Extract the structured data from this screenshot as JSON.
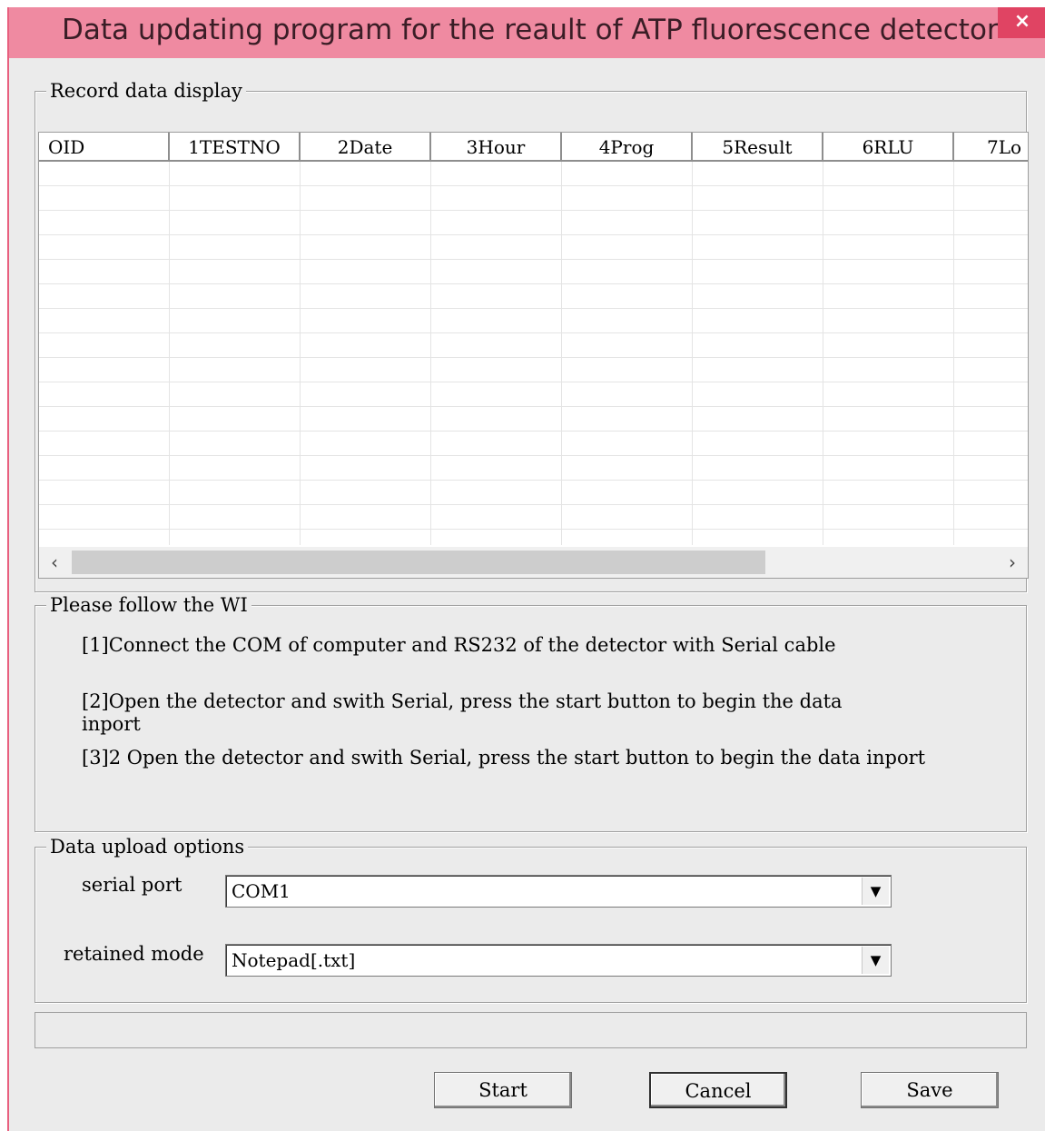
{
  "window": {
    "title": "Data updating program for the reault of ATP fluorescence detector",
    "close_label": "×"
  },
  "record_group": {
    "legend": "Record data display",
    "columns": [
      "OID",
      "1TESTNO",
      "2Date",
      "3Hour",
      "4Prog",
      "5Result",
      "6RLU",
      "7Lo"
    ],
    "rows": [],
    "scroll_left": "‹",
    "scroll_right": "›"
  },
  "wi_group": {
    "legend": "Please follow the WI",
    "steps": [
      "[1]Connect the COM of computer and RS232 of the detector with Serial cable",
      "[2]Open the detector and swith Serial, press the start button to begin the data inport",
      "[3]2  Open the detector and swith Serial, press the start button to begin the data inport"
    ]
  },
  "upload_group": {
    "legend": "Data upload options",
    "serial_port_label": "serial port",
    "serial_port_value": "COM1",
    "retained_mode_label": "retained mode",
    "retained_mode_value": "Notepad[.txt]",
    "dropdown_arrow": "▼"
  },
  "status": {
    "text": ""
  },
  "buttons": {
    "start": "Start",
    "cancel": "Cancel",
    "save": "Save"
  },
  "colors": {
    "titlebar": "#ef8aa1",
    "close_button": "#e04463",
    "window_bg": "#ebebeb"
  }
}
